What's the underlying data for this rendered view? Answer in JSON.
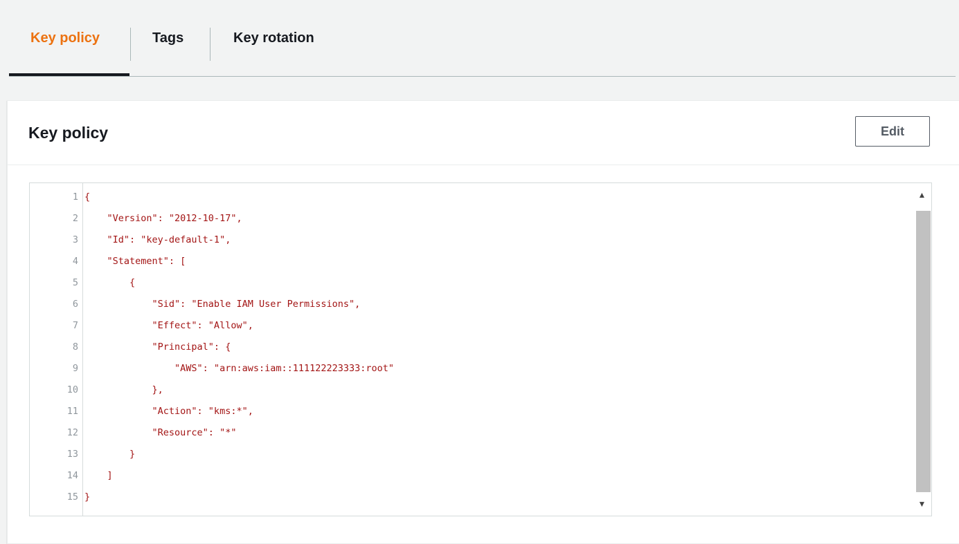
{
  "tabs": [
    {
      "label": "Key policy",
      "active": true
    },
    {
      "label": "Tags",
      "active": false
    },
    {
      "label": "Key rotation",
      "active": false
    }
  ],
  "panel": {
    "title": "Key policy",
    "edit_label": "Edit"
  },
  "editor": {
    "lines": [
      {
        "num": "1",
        "code": "{"
      },
      {
        "num": "2",
        "code": "    \"Version\": \"2012-10-17\","
      },
      {
        "num": "3",
        "code": "    \"Id\": \"key-default-1\","
      },
      {
        "num": "4",
        "code": "    \"Statement\": ["
      },
      {
        "num": "5",
        "code": "        {"
      },
      {
        "num": "6",
        "code": "            \"Sid\": \"Enable IAM User Permissions\","
      },
      {
        "num": "7",
        "code": "            \"Effect\": \"Allow\","
      },
      {
        "num": "8",
        "code": "            \"Principal\": {"
      },
      {
        "num": "9",
        "code": "                \"AWS\": \"arn:aws:iam::111122223333:root\""
      },
      {
        "num": "10",
        "code": "            },"
      },
      {
        "num": "11",
        "code": "            \"Action\": \"kms:*\","
      },
      {
        "num": "12",
        "code": "            \"Resource\": \"*\""
      },
      {
        "num": "13",
        "code": "        }"
      },
      {
        "num": "14",
        "code": "    ]"
      },
      {
        "num": "15",
        "code": "}"
      }
    ],
    "scroll_up_icon": "triangle-up-icon",
    "scroll_down_icon": "triangle-down-icon"
  },
  "colors": {
    "active_tab": "#ec7211",
    "background": "#f2f3f3",
    "string_text": "#a31515"
  }
}
